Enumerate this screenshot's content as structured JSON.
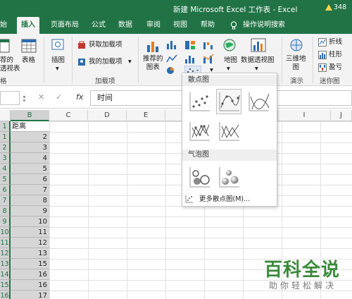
{
  "window": {
    "title": "新建 Microsoft Excel 工作表 - Excel",
    "badge": "348"
  },
  "tabs": [
    "始",
    "插入",
    "页面布局",
    "公式",
    "数据",
    "审阅",
    "视图",
    "帮助",
    "操作说明搜索"
  ],
  "ribbon": {
    "pivot_label": "荐的\n透视表",
    "table_label": "表格",
    "illustrations_label": "插图",
    "get_addins": "获取加载项",
    "my_addins": "我的加载项",
    "recommended_charts": "推荐的\n图表",
    "maps": "地图",
    "pivot_chart": "数据透视图",
    "map3d": "三维地\n图",
    "sparkline_line": "折线",
    "sparkline_column": "柱形",
    "sparkline_winloss": "盈亏",
    "groups": {
      "tables": "格",
      "addins": "加载项",
      "tours": "演示",
      "sparklines": "迷你图"
    }
  },
  "formula_bar": {
    "cancel": "✕",
    "enter": "✓",
    "fx": "fx",
    "value": "时间"
  },
  "columns": [
    "B",
    "C",
    "D",
    "E",
    "I",
    "J"
  ],
  "rows": [
    {
      "n": "1",
      "v": "距离"
    },
    {
      "n": "1",
      "v": "2"
    },
    {
      "n": "2",
      "v": "3"
    },
    {
      "n": "3",
      "v": "4"
    },
    {
      "n": "4",
      "v": "5"
    },
    {
      "n": "5",
      "v": "6"
    },
    {
      "n": "6",
      "v": "7"
    },
    {
      "n": "7",
      "v": "8"
    },
    {
      "n": "8",
      "v": "9"
    },
    {
      "n": "9",
      "v": "10"
    },
    {
      "n": "10",
      "v": "11"
    },
    {
      "n": "11",
      "v": "12"
    },
    {
      "n": "12",
      "v": "13"
    },
    {
      "n": "13",
      "v": "15"
    },
    {
      "n": "14",
      "v": "16"
    },
    {
      "n": "15",
      "v": "16"
    },
    {
      "n": "16",
      "v": "17"
    }
  ],
  "dropdown": {
    "scatter_header": "散点图",
    "bubble_header": "气泡图",
    "more": "更多散点图(M)..."
  },
  "watermark": {
    "title": "百科全说",
    "subtitle": "助你轻松解决"
  },
  "colors": {
    "excel_green": "#217346",
    "selected_gray": "#d6d6d6"
  }
}
